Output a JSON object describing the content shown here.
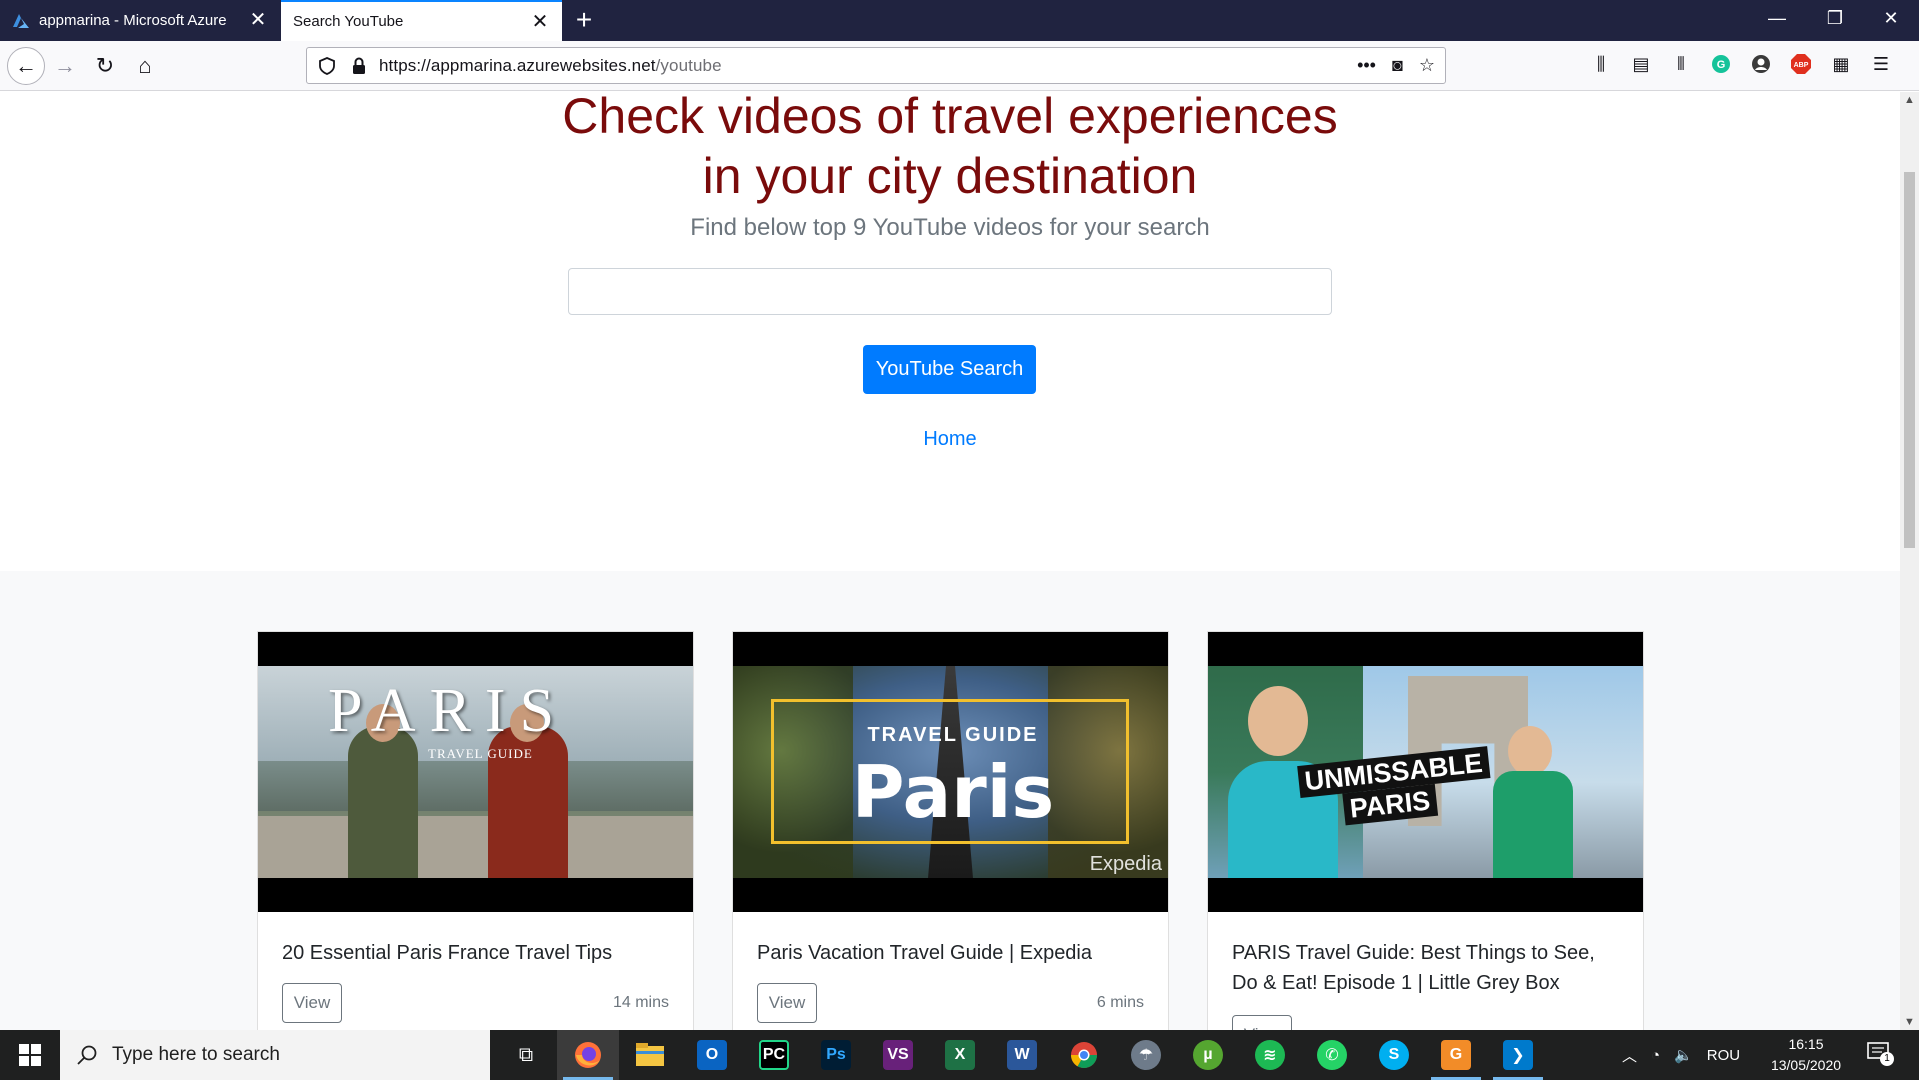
{
  "browser": {
    "tabs": [
      {
        "title": "appmarina - Microsoft Azure",
        "active": false
      },
      {
        "title": "Search YouTube",
        "active": true
      }
    ],
    "url_host": "https://appmarina.azurewebsites.net",
    "url_path": "/youtube",
    "accent_color": "#0a84ff"
  },
  "page": {
    "title_line1": "Check videos of travel experiences",
    "title_line2": "in your city destination",
    "subtitle": "Find below top 9 YouTube videos for your search",
    "search_value": "",
    "search_button": "YouTube Search",
    "home_link": "Home",
    "title_color": "#7a0b0b",
    "button_color": "#007bff"
  },
  "videos": [
    {
      "title": "20 Essential Paris France Travel Tips",
      "view_label": "View",
      "duration": "14 mins",
      "thumb_text": "PARIS",
      "thumb_sub": "TRAVEL GUIDE"
    },
    {
      "title": "Paris Vacation Travel Guide | Expedia",
      "view_label": "View",
      "duration": "6 mins",
      "thumb_small": "TRAVEL GUIDE",
      "thumb_big": "Paris",
      "thumb_brand": "Expedia"
    },
    {
      "title": "PARIS Travel Guide: Best Things to See, Do & Eat! Episode 1 | Little Grey Box",
      "view_label": "View",
      "thumb_line1": "UNMISSABLE",
      "thumb_line2": "PARIS"
    }
  ],
  "taskbar": {
    "search_placeholder": "Type here to search",
    "language": "ROU",
    "time": "16:15",
    "date": "13/05/2020",
    "notification_count": "1"
  }
}
